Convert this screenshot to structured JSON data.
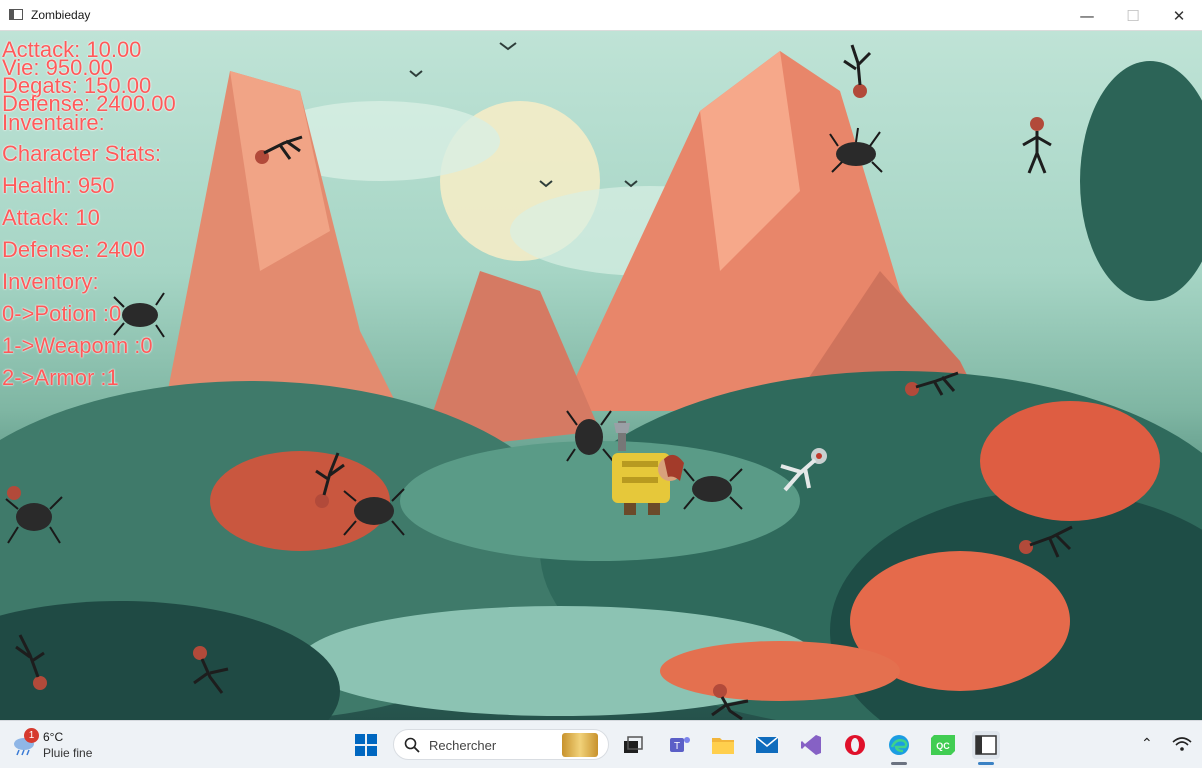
{
  "window": {
    "title": "Zombieday",
    "minimize_glyph": "—",
    "maximize_glyph": "☐",
    "close_glyph": "✕"
  },
  "hud": {
    "top_lines": [
      "Acttack: 10.00",
      "Vie: 950.00",
      "Degats: 150.00",
      "Defense: 2400.00",
      "Inventaire:"
    ],
    "stats_lines": [
      " Character Stats:",
      "Health: 950",
      "Attack: 10",
      "Defense: 2400",
      "Inventory:",
      "0->Potion :0",
      "1->Weaponn :0",
      "2->Armor :1"
    ],
    "text_color": "#ff5a5a"
  },
  "sprites": [
    "zombie-sprite",
    "spider-sprite",
    "player-knight"
  ],
  "taskbar": {
    "weather_badge": "1",
    "weather_temp": "6°C",
    "weather_desc": "Pluie fine",
    "search_placeholder": "Rechercher",
    "apps": [
      "start-icon",
      "search-icon",
      "task-view-icon",
      "teams-icon",
      "file-explorer-icon",
      "mail-icon",
      "visual-studio-icon",
      "opera-icon",
      "edge-icon",
      "qt-creator-icon",
      "zombieday-app-icon"
    ],
    "colors": {
      "start": "#0067c0",
      "teams": "#5b5fc7",
      "folder": "#f2b53a",
      "mail": "#0f6cbd",
      "vs": "#8661c5",
      "opera": "#e0112b",
      "edge": "#1b9de2",
      "qt": "#41cd52"
    }
  }
}
